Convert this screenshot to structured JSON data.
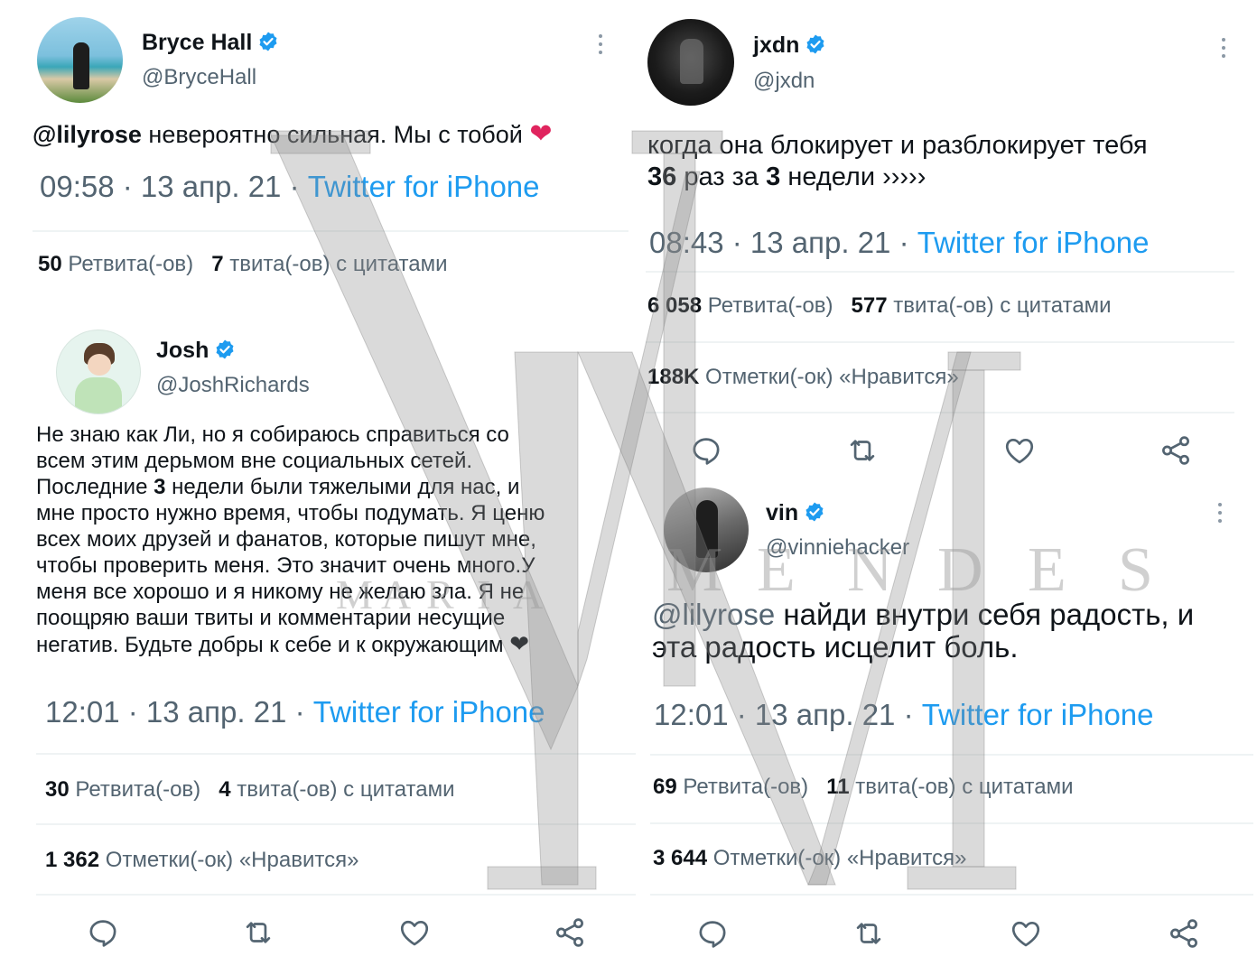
{
  "tweets": {
    "bryce": {
      "name": "Bryce Hall",
      "handle": "@BryceHall",
      "mention": "@lilyrose",
      "text": "невероятно сильная. Мы с тобой",
      "time": "09:58 · 13 апр. 21 · ",
      "source": "Twitter for iPhone",
      "retweets_count": "50",
      "retweets_label": "Ретвита(-ов)",
      "quotes_count": "7",
      "quotes_label": "твита(-ов) с цитатами"
    },
    "josh": {
      "name": "Josh",
      "handle": "@JoshRichards",
      "text_lines": [
        "Не знаю как Ли, но я собираюсь справиться со",
        "всем этим дерьмом вне социальных сетей.",
        "недели были тяжелыми для нас, и",
        "мне просто нужно время, чтобы подумать. Я ценю",
        "всех моих друзей и фанатов, которые пишут мне,",
        "чтобы проверить меня. Это значит очень много.У",
        "меня все хорошо и я никому не желаю зла. Я не",
        "поощряю ваши твиты и комментарии несущие",
        "негатив. Будьте добры к себе и к окружающим"
      ],
      "line3_prefix": "Последние",
      "line3_bold": "3",
      "time": "12:01 · 13 апр. 21 · ",
      "source": "Twitter for iPhone",
      "retweets_count": "30",
      "retweets_label": "Ретвита(-ов)",
      "quotes_count": "4",
      "quotes_label": "твита(-ов) с цитатами",
      "likes_count": "1 362",
      "likes_label": "Отметки(-ок) «Нравится»"
    },
    "jxdn": {
      "name": "jxdn",
      "handle": "@jxdn",
      "line1": "когда она блокирует и разблокирует тебя",
      "line2_n1": "36",
      "line2_mid": "раз за",
      "line2_n2": "3",
      "line2_end": "недели ›››››",
      "time": "08:43 · 13 апр. 21 · ",
      "source": "Twitter for iPhone",
      "retweets_count": "6 058",
      "retweets_label": "Ретвита(-ов)",
      "quotes_count": "577",
      "quotes_label": "твита(-ов) с цитатами",
      "likes_count": "188K",
      "likes_label": "Отметки(-ок) «Нравится»"
    },
    "vin": {
      "name": "vin",
      "handle": "@vinniehacker",
      "mention": "@lilyrose",
      "line1": "найди внутри себя радость, и",
      "line2": "эта радость исцелит боль.",
      "time": "12:01 · 13 апр. 21 · ",
      "source": "Twitter for iPhone",
      "retweets_count": "69",
      "retweets_label": "Ретвита(-ов)",
      "quotes_count": "11",
      "quotes_label": "твита(-ов) с цитатами",
      "likes_count": "3 644",
      "likes_label": "Отметки(-ок) «Нравится»"
    }
  },
  "icons": {
    "reply": "reply-icon",
    "retweet": "retweet-icon",
    "like": "like-icon",
    "share": "share-icon",
    "verified": "verified-badge-icon",
    "more": "more-options-icon"
  },
  "watermark": {
    "letters": [
      "M",
      "A",
      "R",
      "I",
      "A",
      "M",
      "E",
      "N",
      "D",
      "E",
      "S"
    ]
  },
  "colors": {
    "link": "#1d9bf0",
    "verified": "#1d9bf0",
    "text": "#0f1419",
    "secondary": "#536471",
    "heart": "#f91880"
  }
}
